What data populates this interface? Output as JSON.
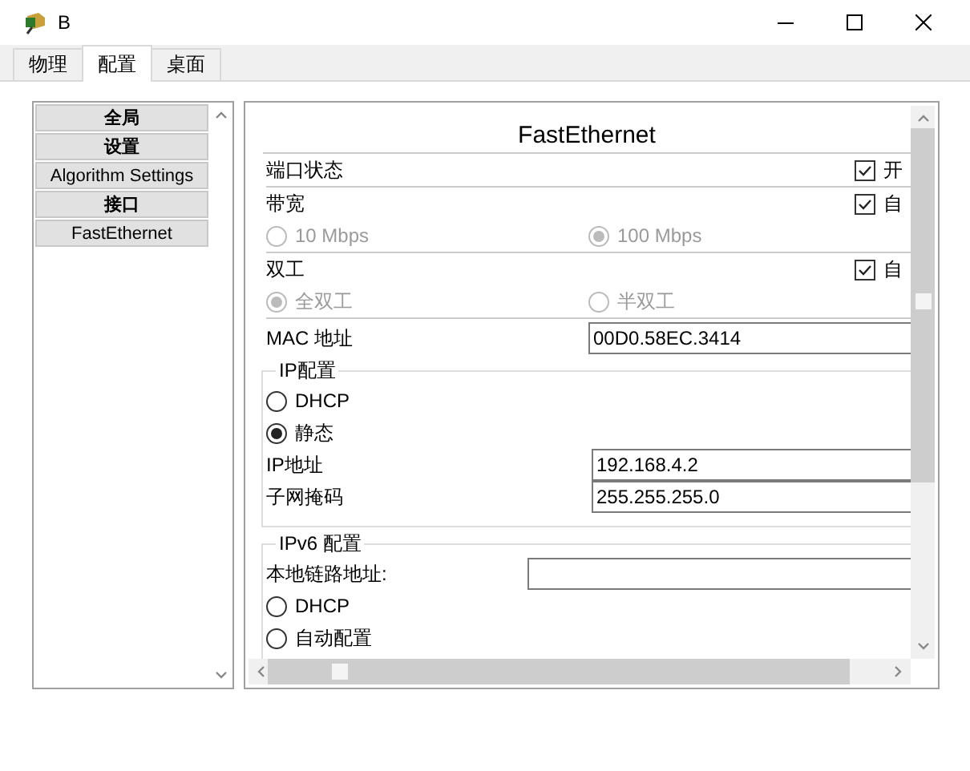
{
  "window": {
    "title": "B"
  },
  "tabs": [
    {
      "label": "物理",
      "selected": false
    },
    {
      "label": "配置",
      "selected": true
    },
    {
      "label": "桌面",
      "selected": false
    }
  ],
  "sidebar": {
    "items": [
      {
        "label": "全局",
        "kind": "header"
      },
      {
        "label": "设置",
        "kind": "header"
      },
      {
        "label": "Algorithm Settings",
        "kind": "item"
      },
      {
        "label": "接口",
        "kind": "header"
      },
      {
        "label": "FastEthernet",
        "kind": "item"
      }
    ]
  },
  "panel": {
    "title": "FastEthernet",
    "port_status": {
      "label": "端口状态",
      "checkbox": {
        "label": "开",
        "checked": true
      }
    },
    "bandwidth": {
      "label": "带宽",
      "checkbox": {
        "label": "自",
        "checked": true
      },
      "disabled": true,
      "options": [
        {
          "label": "10 Mbps",
          "selected": false
        },
        {
          "label": "100 Mbps",
          "selected": true
        }
      ]
    },
    "duplex": {
      "label": "双工",
      "checkbox": {
        "label": "自",
        "checked": true
      },
      "disabled": true,
      "options": [
        {
          "label": "全双工",
          "selected": true
        },
        {
          "label": "半双工",
          "selected": false
        }
      ]
    },
    "mac_address": {
      "label": "MAC 地址",
      "value": "00D0.58EC.3414"
    },
    "ip_config": {
      "legend": "IP配置",
      "options": [
        {
          "label": "DHCP",
          "selected": false
        },
        {
          "label": "静态",
          "selected": true
        }
      ],
      "ip_address": {
        "label": "IP地址",
        "value": "192.168.4.2"
      },
      "subnet_mask": {
        "label": "子网掩码",
        "value": "255.255.255.0"
      }
    },
    "ipv6_config": {
      "legend": "IPv6 配置",
      "link_local": {
        "label": "本地链路地址:"
      },
      "options": [
        {
          "label": "DHCP",
          "selected": false
        },
        {
          "label": "自动配置",
          "selected": false
        }
      ]
    }
  }
}
